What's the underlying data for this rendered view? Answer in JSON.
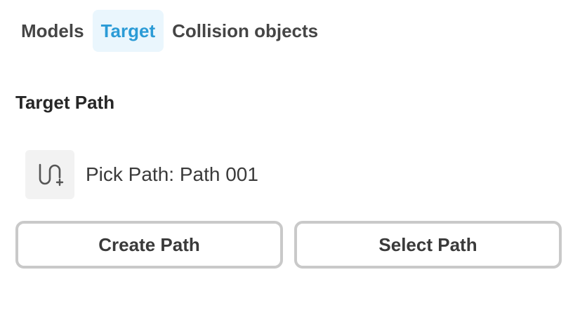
{
  "tabs": [
    {
      "label": "Models",
      "active": false
    },
    {
      "label": "Target",
      "active": true
    },
    {
      "label": "Collision objects",
      "active": false
    }
  ],
  "colors": {
    "active_tab_bg": "#eaf6fd",
    "active_tab_text": "#2b9bd6",
    "button_border": "#c9c9c9"
  },
  "section": {
    "title": "Target Path"
  },
  "pick": {
    "icon": "path-add-icon",
    "label": "Pick Path: Path 001"
  },
  "buttons": {
    "create_label": "Create Path",
    "select_label": "Select Path"
  }
}
